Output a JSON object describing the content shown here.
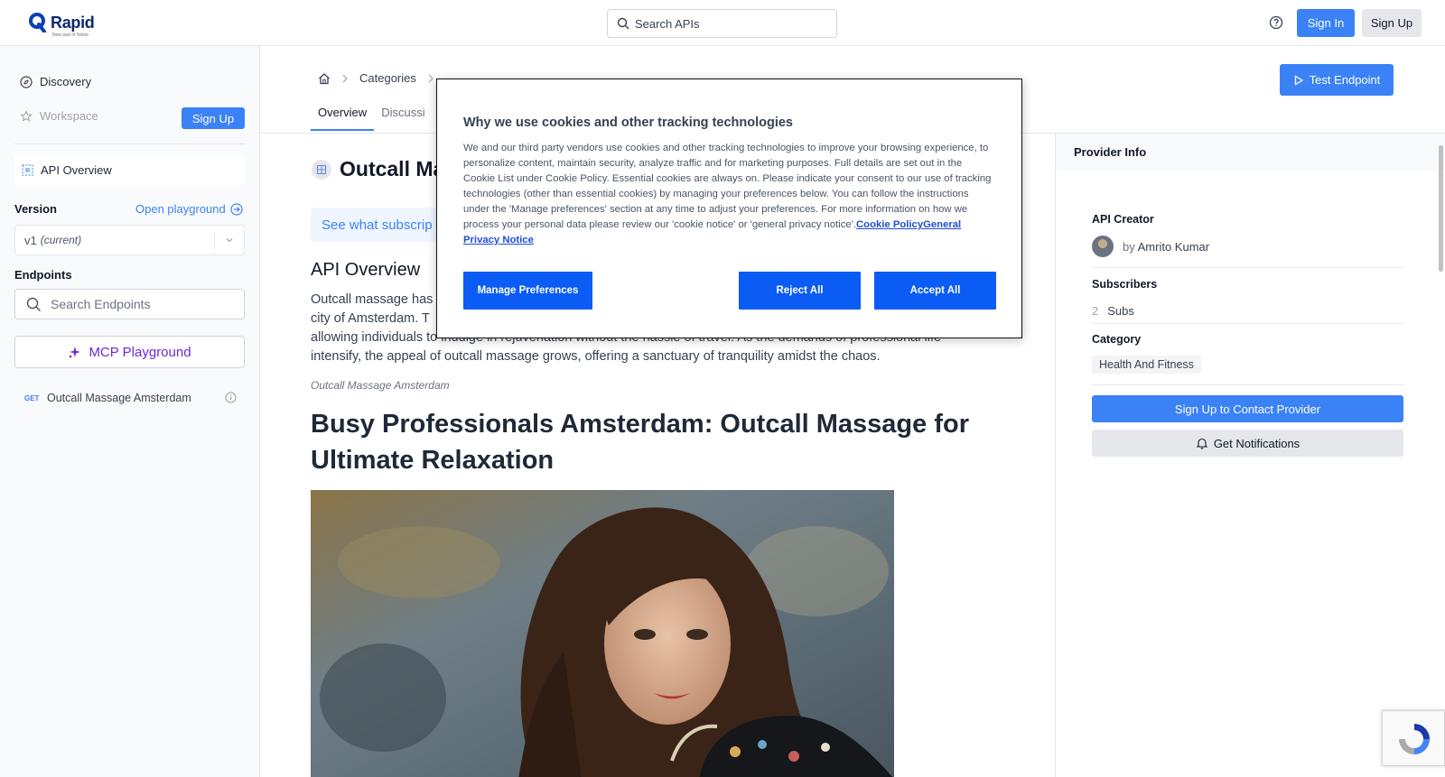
{
  "topnav": {
    "logo_text": "Rapid",
    "logo_sub": "Now part of Nokia",
    "search_placeholder": "Search APIs",
    "sign_in": "Sign In",
    "sign_up": "Sign Up"
  },
  "sidebar": {
    "discovery": "Discovery",
    "workspace": "Workspace",
    "sign_up": "Sign Up",
    "api_overview": "API Overview",
    "version_label": "Version",
    "open_playground": "Open playground",
    "version_value": "v1",
    "version_current": "(current)",
    "endpoints_label": "Endpoints",
    "search_endpoints": "Search Endpoints",
    "mcp_playground": "MCP Playground",
    "endpoint": {
      "method": "GET",
      "name": "Outcall Massage Amsterdam"
    }
  },
  "main": {
    "breadcrumb": {
      "categories": "Categories"
    },
    "test_endpoint": "Test Endpoint",
    "tabs": [
      {
        "label": "Overview"
      },
      {
        "label": "Discussi"
      }
    ],
    "api_title": "Outcall Ma",
    "sub_banner": "See what subscrip",
    "overview_heading": "API Overview",
    "paragraph": [
      "Outcall massage has",
      "city of Amsterdam. T",
      "allowing individuals to indulge in rejuvenation without the hassle of travel. As the demands of professional life",
      "intensify, the appeal of outcall massage grows, offering a sanctuary of tranquility amidst the chaos."
    ],
    "caption": "Outcall Massage Amsterdam",
    "big_heading": "Busy Professionals Amsterdam: Outcall Massage for Ultimate Relaxation"
  },
  "provider": {
    "header": "Provider Info",
    "creator_label": "API Creator",
    "creator_by": "by",
    "creator_name": "Amrito Kumar",
    "subscribers_label": "Subscribers",
    "subscribers_count": "2",
    "subscribers_unit": "Subs",
    "category_label": "Category",
    "category_value": "Health And Fitness",
    "contact_button": "Sign Up to Contact Provider",
    "notify_button": "Get Notifications"
  },
  "cookie": {
    "title": "Why we use cookies and other tracking technologies",
    "body": "We and our third party vendors use cookies and other tracking technologies to improve your browsing experience, to personalize content, maintain security, analyze traffic and for marketing purposes. Full details are set out in the Cookie List under Cookie Policy. Essential cookies are always on. Please indicate your consent to our use of tracking technologies (other than essential cookies) by managing your preferences below. You can follow the instructions under the 'Manage preferences' section at any time to adjust your preferences. For more information on how we process your personal data please review our 'cookie notice' or 'general privacy notice'.",
    "link_cookie_policy": "Cookie Policy",
    "link_privacy": "General Privacy Notice",
    "manage": "Manage Preferences",
    "reject": "Reject All",
    "accept": "Accept All"
  },
  "colors": {
    "accent": "#3b82f6",
    "cookie_button": "#0a5cf5",
    "mcp": "#6d28d9",
    "logo": "#0b2a6f"
  }
}
